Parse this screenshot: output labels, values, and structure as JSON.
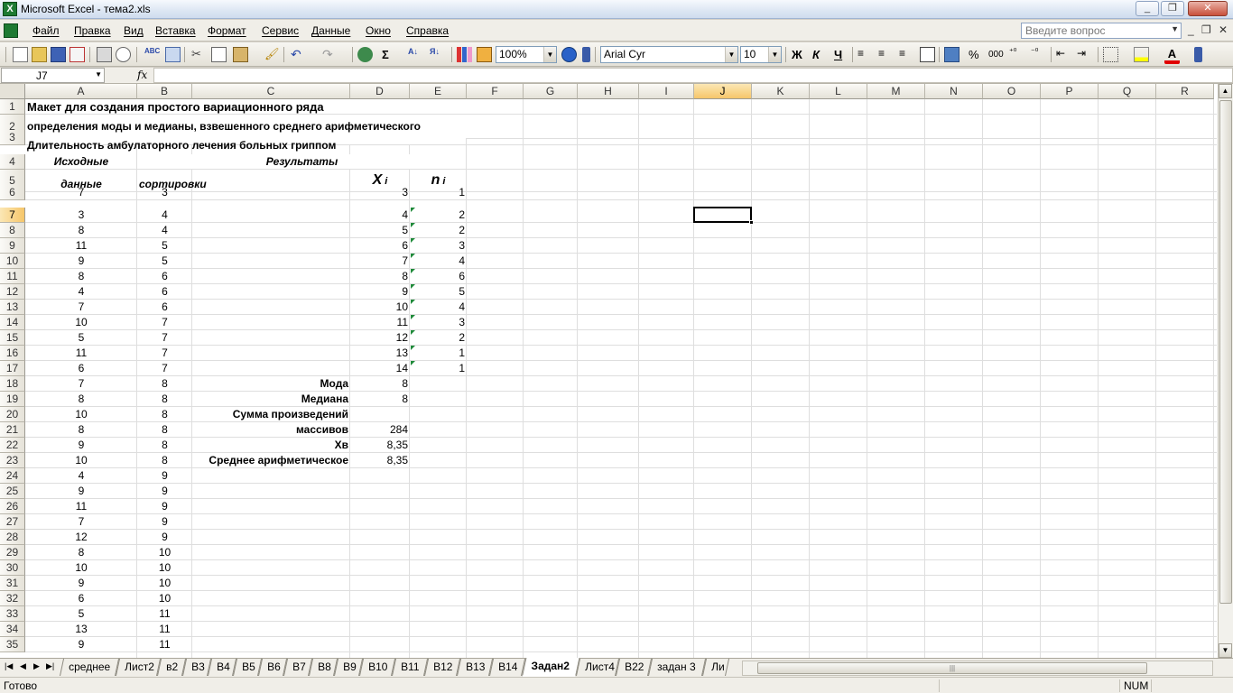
{
  "window": {
    "title": "Microsoft Excel - тема2.xls",
    "app_icon": "excel-icon",
    "controls": [
      "_",
      "❐",
      "✕"
    ]
  },
  "menu": {
    "items": [
      "Файл",
      "Правка",
      "Вид",
      "Вставка",
      "Формат",
      "Сервис",
      "Данные",
      "Окно",
      "Справка"
    ],
    "help_placeholder": "Введите вопрос",
    "mdi_controls": [
      "_",
      "❐",
      "✕"
    ]
  },
  "toolbar": {
    "zoom": "100%",
    "font": "Arial Cyr",
    "size": "10",
    "bold_label": "Ж",
    "italic_label": "К",
    "underline_label": "Ч",
    "percent_label": "%",
    "thousands_label": "000",
    "sigma_label": "Σ"
  },
  "formula_bar": {
    "name_box": "J7",
    "fx_label": "fx",
    "formula": ""
  },
  "grid": {
    "selected_cell": "J7",
    "columns": [
      "A",
      "B",
      "C",
      "D",
      "E",
      "F",
      "G",
      "H",
      "I",
      "J",
      "K",
      "L",
      "M",
      "N",
      "O",
      "P",
      "Q",
      "R"
    ],
    "rows": [
      "1",
      "2",
      "3",
      "4",
      "5",
      "6",
      "7",
      "8",
      "9",
      "10",
      "11",
      "12",
      "13",
      "14",
      "15",
      "16",
      "17",
      "18",
      "19",
      "20",
      "21",
      "22",
      "23",
      "24",
      "25",
      "26",
      "27",
      "28",
      "29",
      "30",
      "31",
      "32",
      "33",
      "34",
      "35"
    ],
    "title_row1": "Макет для создания простого вариационного ряда",
    "title_row2": "определения моды и медианы, взвешенного среднего арифметического",
    "title_row3": "Длительность амбулаторного лечения больных гриппом",
    "hdr_source_1": "Исходные",
    "hdr_source_2": "данные",
    "hdr_results": "Результаты",
    "hdr_sort": "сортировки",
    "hdr_x": "X",
    "hdr_x_sub": "i",
    "hdr_n": "n",
    "hdr_n_sub": "i",
    "col_a": [
      "7",
      "3",
      "8",
      "11",
      "9",
      "8",
      "4",
      "7",
      "10",
      "5",
      "11",
      "6",
      "7",
      "8",
      "10",
      "8",
      "9",
      "10",
      "4",
      "9",
      "11",
      "7",
      "12",
      "8",
      "10",
      "9",
      "6",
      "5",
      "13",
      "9"
    ],
    "col_b": [
      "3",
      "4",
      "4",
      "5",
      "5",
      "6",
      "6",
      "6",
      "7",
      "7",
      "7",
      "7",
      "8",
      "8",
      "8",
      "8",
      "8",
      "8",
      "9",
      "9",
      "9",
      "9",
      "9",
      "10",
      "10",
      "10",
      "10",
      "11",
      "11",
      "11"
    ],
    "col_d": [
      "3",
      "4",
      "5",
      "6",
      "7",
      "8",
      "9",
      "10",
      "11",
      "12",
      "13",
      "14"
    ],
    "col_e": [
      "1",
      "2",
      "2",
      "3",
      "4",
      "6",
      "5",
      "4",
      "3",
      "2",
      "1",
      "1"
    ],
    "labels": {
      "moda": "Мода",
      "mediana": "Медиана",
      "summa1": "Сумма произведений",
      "summa2": "массивов",
      "xv": "Хв",
      "avg": "Среднее арифметическое"
    },
    "values": {
      "moda": "8",
      "mediana": "8",
      "summa": "284",
      "xv": "8,35",
      "avg": "8,35"
    }
  },
  "sheets": {
    "tabs": [
      "среднее",
      "Лист2",
      "в2",
      "В3",
      "В4",
      "В5",
      "В6",
      "В7",
      "В8",
      "В9",
      "В10",
      "В11",
      "В12",
      "В13",
      "В14",
      "Задан2",
      "Лист4",
      "В22",
      "задан 3",
      "Ли"
    ],
    "active": "Задан2"
  },
  "status": {
    "ready": "Готово",
    "num": "NUM"
  }
}
